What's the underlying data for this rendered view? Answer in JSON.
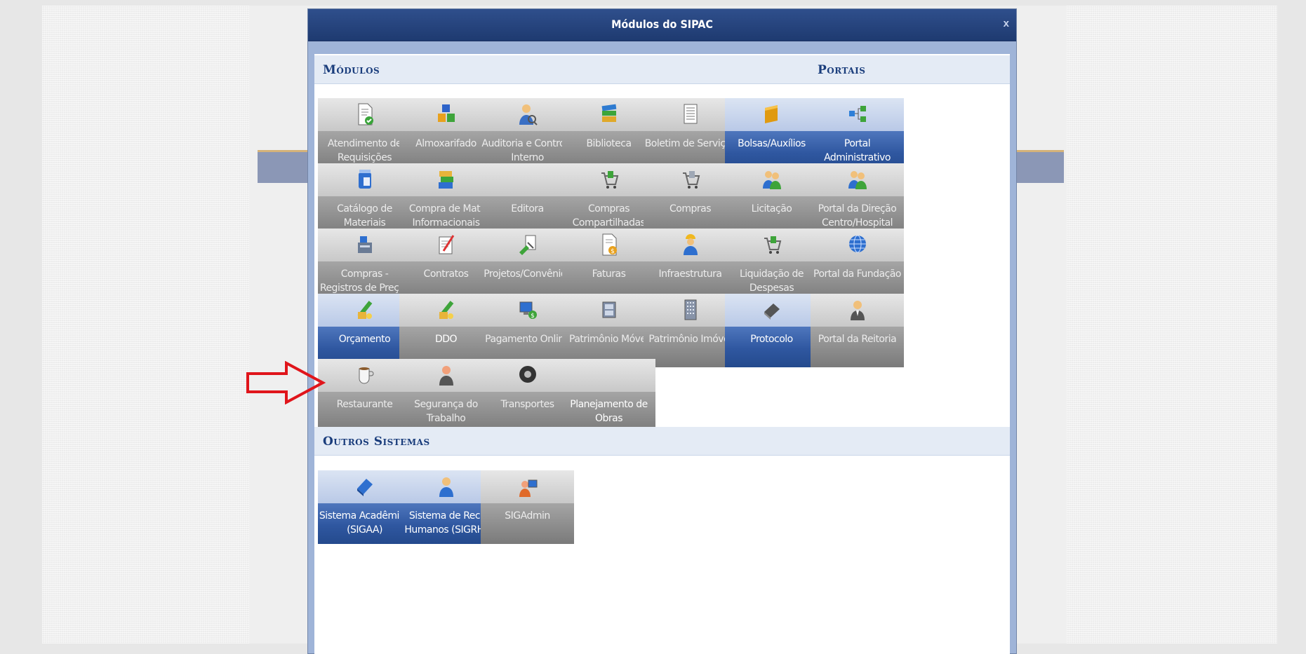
{
  "modal": {
    "title": "Módulos do SIPAC",
    "close": "x"
  },
  "sections": {
    "modulos": "Módulos",
    "portais": "Portais",
    "outros": "Outros Sistemas"
  },
  "modules": {
    "atendimento": "Atendimento de Requisições",
    "almoxarifado": "Almoxarifado",
    "auditoria": "Auditoria e Controle Interno",
    "biblioteca": "Biblioteca",
    "boletim": "Boletim de Serviços",
    "bolsas": "Bolsas/Auxílios",
    "catalogo": "Catálogo de Materiais",
    "compra_mat": "Compra de Mat. Informacionais",
    "editora": "Editora",
    "compras_compart": "Compras Compartilhadas",
    "compras": "Compras",
    "licitacao": "Licitação",
    "compras_registro": "Compras - Registros de Preços",
    "contratos": "Contratos",
    "projetos": "Projetos/Convênios",
    "faturas": "Faturas",
    "infraestrutura": "Infraestrutura",
    "liquidacao": "Liquidação de Despesas",
    "orcamento": "Orçamento",
    "ddo": "DDO",
    "pagamento": "Pagamento Online",
    "patrimonio_movel": "Patrimônio Móvel",
    "patrimonio_imovel": "Patrimônio Imóvel",
    "protocolo": "Protocolo",
    "restaurante": "Restaurante",
    "seguranca": "Segurança do Trabalho",
    "transportes": "Transportes",
    "planejamento": "Planejamento de Obras"
  },
  "portais": {
    "administrativo": "Portal Administrativo",
    "direcao": "Portal da Direção Centro/Hospital",
    "fundacao": "Portal da Fundação",
    "reitoria": "Portal da Reitoria"
  },
  "outros": {
    "sigaa": "Sistema Acadêmico (SIGAA)",
    "sigrh": "Sistema de Rec. Humanos (SIGRH)",
    "sigadmin": "SIGAdmin"
  },
  "colors": {
    "active_tile": "#2f57a0",
    "disabled_tile": "#8d8d8d",
    "header": "#1e3a70",
    "arrow": "#e0151b"
  }
}
